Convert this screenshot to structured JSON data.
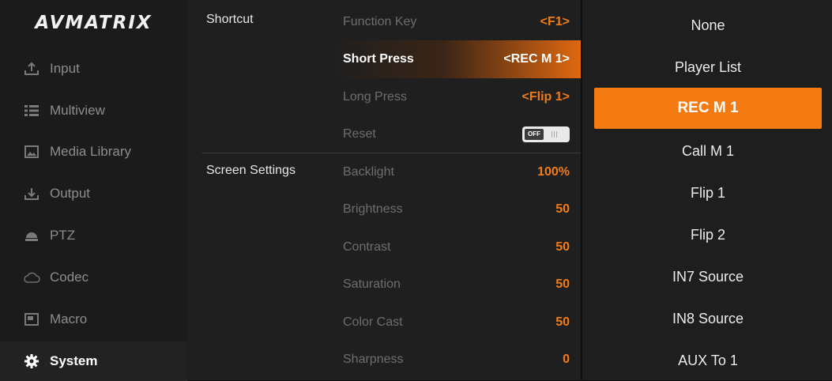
{
  "sidebar": {
    "logo": "AVMATRIX",
    "items": [
      {
        "label": "Input",
        "icon": "upload-icon"
      },
      {
        "label": "Multiview",
        "icon": "list-icon"
      },
      {
        "label": "Media Library",
        "icon": "image-icon"
      },
      {
        "label": "Output",
        "icon": "download-tray-icon"
      },
      {
        "label": "PTZ",
        "icon": "ptz-camera-icon"
      },
      {
        "label": "Codec",
        "icon": "cloud-icon"
      },
      {
        "label": "Macro",
        "icon": "macro-icon"
      },
      {
        "label": "System",
        "icon": "gear-icon",
        "active": true
      }
    ]
  },
  "settings": {
    "shortcut": {
      "title": "Shortcut",
      "rows": [
        {
          "label": "Function Key",
          "value": "<F1>"
        },
        {
          "label": "Short Press",
          "value": "<REC M 1>",
          "selected": true
        },
        {
          "label": "Long Press",
          "value": "<Flip 1>"
        },
        {
          "label": "Reset",
          "toggle": "OFF"
        }
      ]
    },
    "screen": {
      "title": "Screen Settings",
      "rows": [
        {
          "label": "Backlight",
          "value": "100%"
        },
        {
          "label": "Brightness",
          "value": "50"
        },
        {
          "label": "Contrast",
          "value": "50"
        },
        {
          "label": "Saturation",
          "value": "50"
        },
        {
          "label": "Color Cast",
          "value": "50"
        },
        {
          "label": "Sharpness",
          "value": "0"
        }
      ]
    }
  },
  "options": {
    "items": [
      "None",
      "Player List",
      "REC M 1",
      "Call M 1",
      "Flip 1",
      "Flip 2",
      "IN7 Source",
      "IN8 Source",
      "AUX To 1"
    ],
    "selected": "REC M 1"
  },
  "colors": {
    "accent": "#f47a12",
    "value_text": "#f07c1a",
    "sidebar_bg": "#1b1b1b",
    "panel_bg": "#1f1f1f"
  }
}
